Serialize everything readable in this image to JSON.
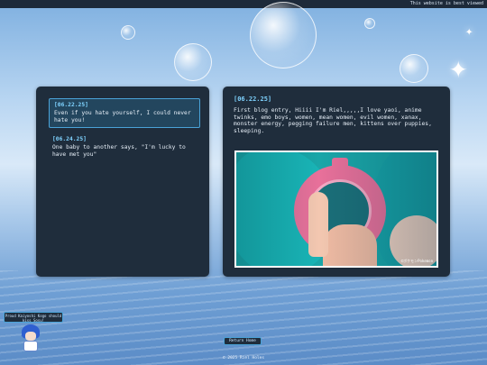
{
  "topbar": {
    "notice": "This website is best viewed"
  },
  "sidebar": {
    "entries": [
      {
        "date": "[06.22.25]",
        "text": "Even if you hate yourself, I could never hate you!"
      },
      {
        "date": "[06.24.25]",
        "text": "One baby to another says, \"I'm lucky to have met you\""
      }
    ]
  },
  "post": {
    "date": "[06.22.25]",
    "body": "First blog entry, Hiiii I'm Riel,,,,,I love yaoi, anime twinks, emo boys, women, mean women, evil women, xanax, monster energy, pegging failure men, kittens over puppies, sleeping.",
    "image_credit": "©ポケモンPokemon"
  },
  "avatar": {
    "label": "Proud Kaiyoshi Kogo should kiss Sosu!"
  },
  "nav": {
    "return_label": "Return Home"
  },
  "footer": {
    "text": "© 2025 Riel Holes"
  }
}
